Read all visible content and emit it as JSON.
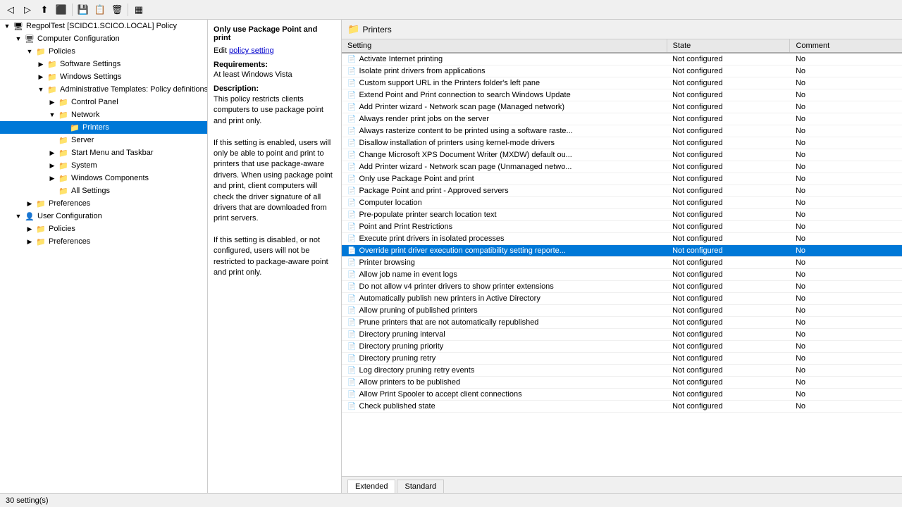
{
  "app": {
    "title": "RegpolTest [SCIDC1.SCICO.LOCAL] Policy",
    "status": "30 setting(s)"
  },
  "toolbar": {
    "buttons": [
      "◁",
      "▷",
      "📁",
      "⬛",
      "💾",
      "📋",
      "🗑",
      "▦"
    ]
  },
  "tree": {
    "items": [
      {
        "id": "root",
        "label": "RegpolTest [SCIDC1.SCICO.LOCAL] Policy",
        "icon": "policy",
        "level": 0,
        "expanded": true
      },
      {
        "id": "comp-config",
        "label": "Computer Configuration",
        "icon": "computer",
        "level": 1,
        "expanded": true
      },
      {
        "id": "policies",
        "label": "Policies",
        "icon": "folder",
        "level": 2,
        "expanded": true
      },
      {
        "id": "software-settings",
        "label": "Software Settings",
        "icon": "folder",
        "level": 3,
        "expanded": false
      },
      {
        "id": "windows-settings",
        "label": "Windows Settings",
        "icon": "folder",
        "level": 3,
        "expanded": false
      },
      {
        "id": "admin-templates",
        "label": "Administrative Templates: Policy definitions (",
        "icon": "folder",
        "level": 3,
        "expanded": true
      },
      {
        "id": "control-panel",
        "label": "Control Panel",
        "icon": "folder",
        "level": 4,
        "expanded": false
      },
      {
        "id": "network",
        "label": "Network",
        "icon": "folder",
        "level": 4,
        "expanded": false
      },
      {
        "id": "printers",
        "label": "Printers",
        "icon": "folder",
        "level": 5,
        "expanded": false,
        "selected": true
      },
      {
        "id": "server",
        "label": "Server",
        "icon": "folder",
        "level": 4,
        "expanded": false
      },
      {
        "id": "start-menu",
        "label": "Start Menu and Taskbar",
        "icon": "folder",
        "level": 4,
        "expanded": false
      },
      {
        "id": "system",
        "label": "System",
        "icon": "folder",
        "level": 4,
        "expanded": false
      },
      {
        "id": "windows-components",
        "label": "Windows Components",
        "icon": "folder",
        "level": 4,
        "expanded": false
      },
      {
        "id": "all-settings",
        "label": "All Settings",
        "icon": "folder",
        "level": 4,
        "expanded": false
      },
      {
        "id": "comp-prefs",
        "label": "Preferences",
        "icon": "folder",
        "level": 2,
        "expanded": false
      },
      {
        "id": "user-config",
        "label": "User Configuration",
        "icon": "computer",
        "level": 1,
        "expanded": true
      },
      {
        "id": "user-policies",
        "label": "Policies",
        "icon": "folder",
        "level": 2,
        "expanded": false
      },
      {
        "id": "user-prefs",
        "label": "Preferences",
        "icon": "folder",
        "level": 2,
        "expanded": false
      }
    ]
  },
  "breadcrumb": {
    "icon": "folder",
    "label": "Printers"
  },
  "detail": {
    "title": "Only use Package Point and print",
    "edit_label": "Edit",
    "policy_link": "policy setting",
    "requirements_title": "Requirements:",
    "requirements_text": "At least Windows Vista",
    "description_title": "Description:",
    "description_text": "This policy restricts clients computers to use package point and print only.\n\nIf this setting is enabled, users will only be able to point and print to printers that use package-aware drivers. When using package point and print, client computers will check the driver signature of all drivers that are downloaded from print servers.\n\nIf this setting is disabled, or not configured, users will not be restricted to package-aware point and print only."
  },
  "table": {
    "columns": [
      "Setting",
      "State",
      "Comment"
    ],
    "selected_row": 16,
    "rows": [
      {
        "setting": "Activate Internet printing",
        "state": "Not configured",
        "comment": "No"
      },
      {
        "setting": "Isolate print drivers from applications",
        "state": "Not configured",
        "comment": "No"
      },
      {
        "setting": "Custom support URL in the Printers folder's left pane",
        "state": "Not configured",
        "comment": "No"
      },
      {
        "setting": "Extend Point and Print connection to search Windows Update",
        "state": "Not configured",
        "comment": "No"
      },
      {
        "setting": "Add Printer wizard - Network scan page (Managed network)",
        "state": "Not configured",
        "comment": "No"
      },
      {
        "setting": "Always render print jobs on the server",
        "state": "Not configured",
        "comment": "No"
      },
      {
        "setting": "Always rasterize content to be printed using a software raste...",
        "state": "Not configured",
        "comment": "No"
      },
      {
        "setting": "Disallow installation of printers using kernel-mode drivers",
        "state": "Not configured",
        "comment": "No"
      },
      {
        "setting": "Change Microsoft XPS Document Writer (MXDW) default ou...",
        "state": "Not configured",
        "comment": "No"
      },
      {
        "setting": "Add Printer wizard - Network scan page (Unmanaged netwo...",
        "state": "Not configured",
        "comment": "No"
      },
      {
        "setting": "Only use Package Point and print",
        "state": "Not configured",
        "comment": "No"
      },
      {
        "setting": "Package Point and print - Approved servers",
        "state": "Not configured",
        "comment": "No"
      },
      {
        "setting": "Computer location",
        "state": "Not configured",
        "comment": "No"
      },
      {
        "setting": "Pre-populate printer search location text",
        "state": "Not configured",
        "comment": "No"
      },
      {
        "setting": "Point and Print Restrictions",
        "state": "Not configured",
        "comment": "No"
      },
      {
        "setting": "Execute print drivers in isolated processes",
        "state": "Not configured",
        "comment": "No"
      },
      {
        "setting": "Override print driver execution compatibility setting reporte...",
        "state": "Not configured",
        "comment": "No"
      },
      {
        "setting": "Printer browsing",
        "state": "Not configured",
        "comment": "No"
      },
      {
        "setting": "Allow job name in event logs",
        "state": "Not configured",
        "comment": "No"
      },
      {
        "setting": "Do not allow v4 printer drivers to show printer extensions",
        "state": "Not configured",
        "comment": "No"
      },
      {
        "setting": "Automatically publish new printers in Active Directory",
        "state": "Not configured",
        "comment": "No"
      },
      {
        "setting": "Allow pruning of published printers",
        "state": "Not configured",
        "comment": "No"
      },
      {
        "setting": "Prune printers that are not automatically republished",
        "state": "Not configured",
        "comment": "No"
      },
      {
        "setting": "Directory pruning interval",
        "state": "Not configured",
        "comment": "No"
      },
      {
        "setting": "Directory pruning priority",
        "state": "Not configured",
        "comment": "No"
      },
      {
        "setting": "Directory pruning retry",
        "state": "Not configured",
        "comment": "No"
      },
      {
        "setting": "Log directory pruning retry events",
        "state": "Not configured",
        "comment": "No"
      },
      {
        "setting": "Allow printers to be published",
        "state": "Not configured",
        "comment": "No"
      },
      {
        "setting": "Allow Print Spooler to accept client connections",
        "state": "Not configured",
        "comment": "No"
      },
      {
        "setting": "Check published state",
        "state": "Not configured",
        "comment": "No"
      }
    ]
  },
  "tabs": [
    {
      "label": "Extended",
      "active": true
    },
    {
      "label": "Standard",
      "active": false
    }
  ]
}
